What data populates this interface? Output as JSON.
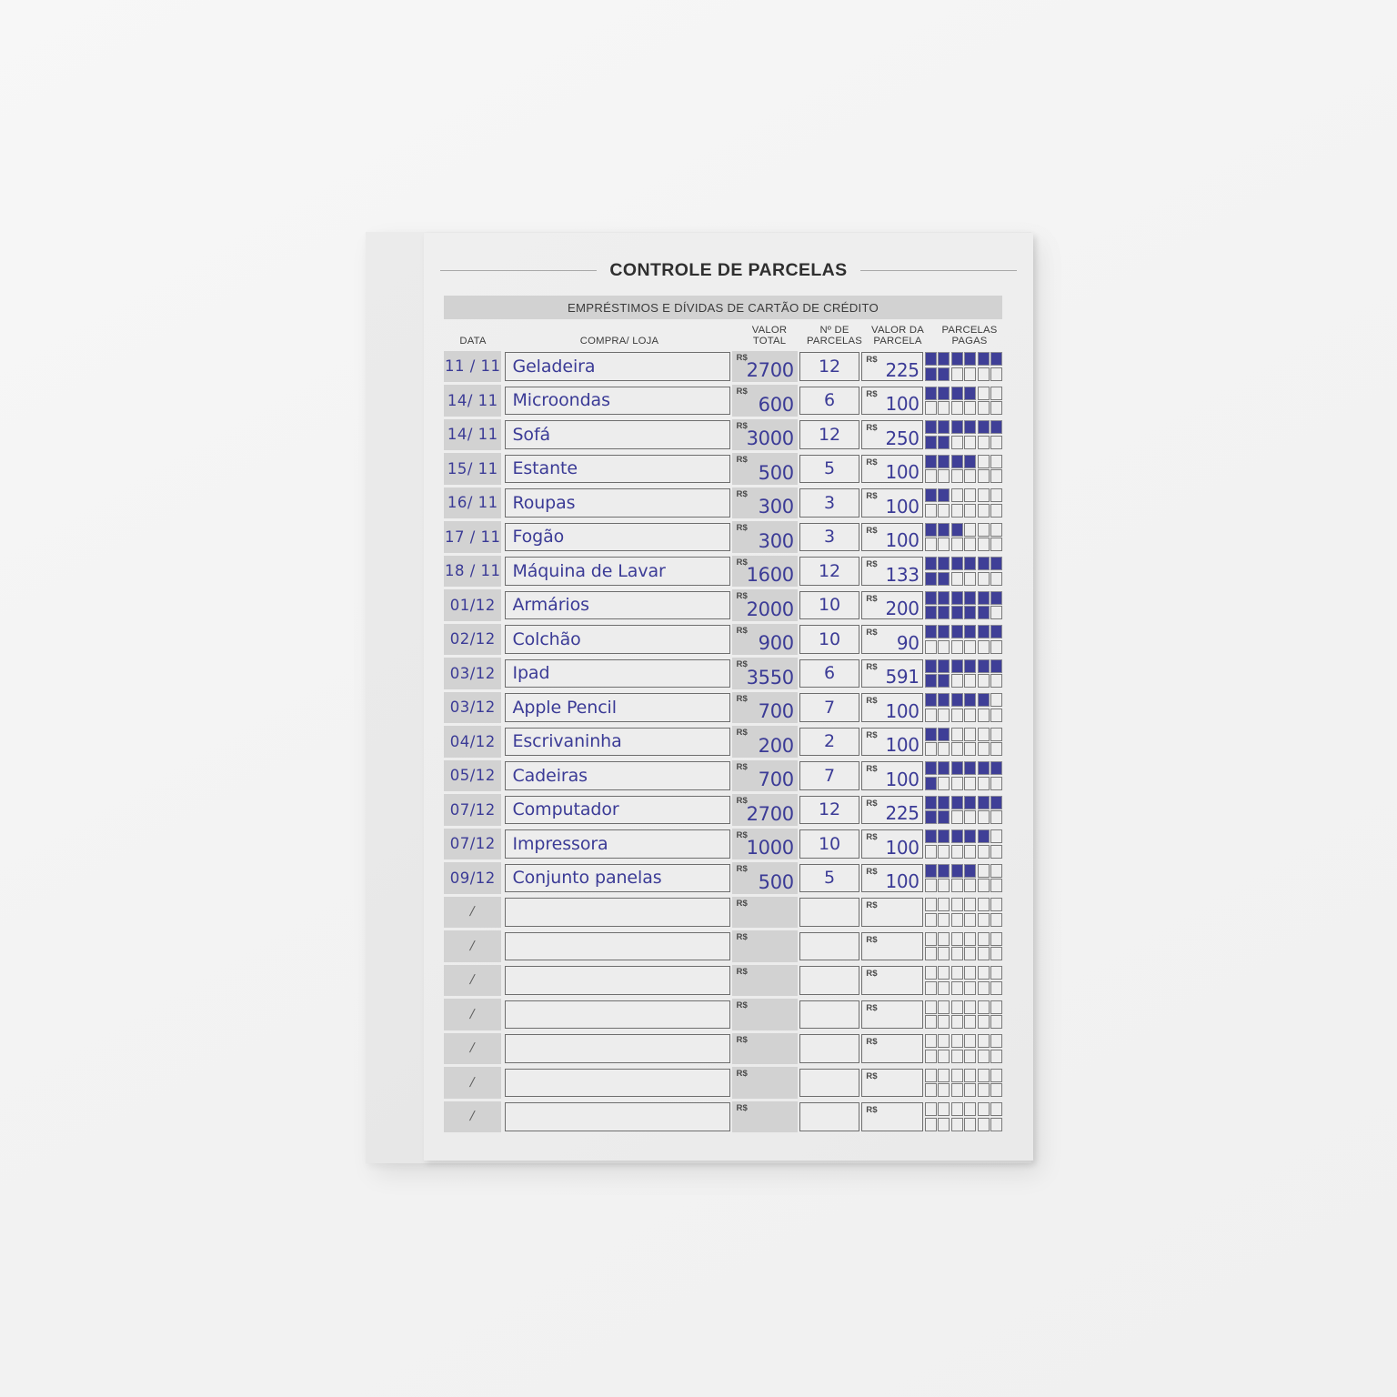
{
  "sheet": {
    "title": "CONTROLE DE PARCELAS",
    "subtitle": "EMPRÉSTIMOS E DÍVIDAS DE CARTÃO DE CRÉDITO"
  },
  "colors": {
    "ink": "#3b3b96",
    "checkbox_filled": "#3f3f97",
    "header_band": "#d2d2d2",
    "paper": "#ededed"
  },
  "columns": {
    "date": "DATA",
    "store": "COMPRA/ LOJA",
    "total_l1": "VALOR",
    "total_l2": "TOTAL",
    "nparc_l1": "Nº DE",
    "nparc_l2": "PARCELAS",
    "parcval_l1": "VALOR DA",
    "parcval_l2": "PARCELA",
    "paid_l1": "PARCELAS",
    "paid_l2": "PAGAS"
  },
  "currency_label": "R$",
  "blank_date_mark": "/",
  "checkbox_slots": 12,
  "rows": [
    {
      "date": "11 / 11",
      "store": "Geladeira",
      "total": "2700",
      "nparc": "12",
      "parcval": "225",
      "paid": 8,
      "blank": false
    },
    {
      "date": "14/ 11",
      "store": "Microondas",
      "total": "600",
      "nparc": "6",
      "parcval": "100",
      "paid": 4,
      "blank": false
    },
    {
      "date": "14/ 11",
      "store": "Sofá",
      "total": "3000",
      "nparc": "12",
      "parcval": "250",
      "paid": 8,
      "blank": false
    },
    {
      "date": "15/ 11",
      "store": "Estante",
      "total": "500",
      "nparc": "5",
      "parcval": "100",
      "paid": 4,
      "blank": false
    },
    {
      "date": "16/ 11",
      "store": "Roupas",
      "total": "300",
      "nparc": "3",
      "parcval": "100",
      "paid": 2,
      "blank": false
    },
    {
      "date": "17 / 11",
      "store": "Fogão",
      "total": "300",
      "nparc": "3",
      "parcval": "100",
      "paid": 3,
      "blank": false
    },
    {
      "date": "18 / 11",
      "store": "Máquina de Lavar",
      "total": "1600",
      "nparc": "12",
      "parcval": "133",
      "paid": 8,
      "blank": false
    },
    {
      "date": "01/12",
      "store": "Armários",
      "total": "2000",
      "nparc": "10",
      "parcval": "200",
      "paid": 11,
      "blank": false
    },
    {
      "date": "02/12",
      "store": "Colchão",
      "total": "900",
      "nparc": "10",
      "parcval": "90",
      "paid": 6,
      "blank": false
    },
    {
      "date": "03/12",
      "store": "Ipad",
      "total": "3550",
      "nparc": "6",
      "parcval": "591",
      "paid": 8,
      "blank": false
    },
    {
      "date": "03/12",
      "store": "Apple Pencil",
      "total": "700",
      "nparc": "7",
      "parcval": "100",
      "paid": 5,
      "blank": false
    },
    {
      "date": "04/12",
      "store": "Escrivaninha",
      "total": "200",
      "nparc": "2",
      "parcval": "100",
      "paid": 2,
      "blank": false
    },
    {
      "date": "05/12",
      "store": "Cadeiras",
      "total": "700",
      "nparc": "7",
      "parcval": "100",
      "paid": 7,
      "blank": false
    },
    {
      "date": "07/12",
      "store": "Computador",
      "total": "2700",
      "nparc": "12",
      "parcval": "225",
      "paid": 8,
      "blank": false
    },
    {
      "date": "07/12",
      "store": "Impressora",
      "total": "1000",
      "nparc": "10",
      "parcval": "100",
      "paid": 5,
      "blank": false
    },
    {
      "date": "09/12",
      "store": "Conjunto panelas",
      "total": "500",
      "nparc": "5",
      "parcval": "100",
      "paid": 4,
      "blank": false
    },
    {
      "date": "/",
      "store": "",
      "total": "",
      "nparc": "",
      "parcval": "",
      "paid": 0,
      "blank": true
    },
    {
      "date": "/",
      "store": "",
      "total": "",
      "nparc": "",
      "parcval": "",
      "paid": 0,
      "blank": true
    },
    {
      "date": "/",
      "store": "",
      "total": "",
      "nparc": "",
      "parcval": "",
      "paid": 0,
      "blank": true
    },
    {
      "date": "/",
      "store": "",
      "total": "",
      "nparc": "",
      "parcval": "",
      "paid": 0,
      "blank": true
    },
    {
      "date": "/",
      "store": "",
      "total": "",
      "nparc": "",
      "parcval": "",
      "paid": 0,
      "blank": true
    },
    {
      "date": "/",
      "store": "",
      "total": "",
      "nparc": "",
      "parcval": "",
      "paid": 0,
      "blank": true
    },
    {
      "date": "/",
      "store": "",
      "total": "",
      "nparc": "",
      "parcval": "",
      "paid": 0,
      "blank": true
    }
  ]
}
